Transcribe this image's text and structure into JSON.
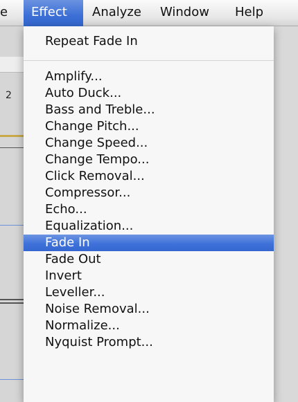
{
  "menubar": {
    "items": [
      {
        "label": "e",
        "active": false
      },
      {
        "label": "Effect",
        "active": true
      },
      {
        "label": "Analyze",
        "active": false
      },
      {
        "label": "Window",
        "active": false
      },
      {
        "label": "Help",
        "active": false
      }
    ]
  },
  "background": {
    "left_number": "2"
  },
  "effect_menu": {
    "repeat_item": "Repeat Fade In",
    "items": [
      "Amplify...",
      "Auto Duck...",
      "Bass and Treble...",
      "Change Pitch...",
      "Change Speed...",
      "Change Tempo...",
      "Click Removal...",
      "Compressor...",
      "Echo...",
      "Equalization...",
      "Fade In",
      "Fade Out",
      "Invert",
      "Leveller...",
      "Noise Removal...",
      "Normalize...",
      "Nyquist Prompt..."
    ],
    "highlighted": "Fade In"
  },
  "colors": {
    "selection": "#3f72d9",
    "menu_background": "#f8f8f8"
  }
}
